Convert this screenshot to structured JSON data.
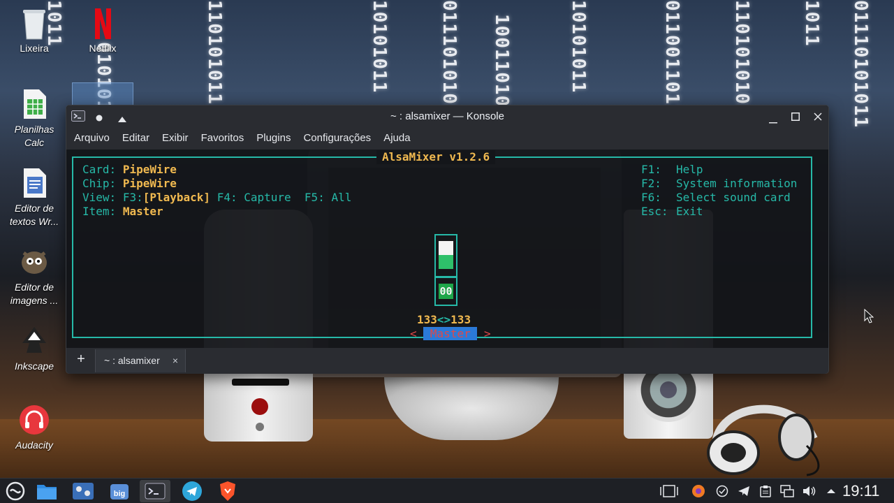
{
  "desktop": {
    "icons": [
      {
        "label": "Lixeira",
        "icon": "trash-icon"
      },
      {
        "label": "Netflix",
        "icon": "netflix-icon"
      },
      {
        "label": "Planilhas Calc",
        "icon": "spreadsheet-icon"
      },
      {
        "label": "Editor de textos Wr...",
        "icon": "text-document-icon"
      },
      {
        "label": "Editor de imagens ...",
        "icon": "gimp-icon"
      },
      {
        "label": "Inkscape",
        "icon": "inkscape-icon"
      },
      {
        "label": "Audacity",
        "icon": "audacity-icon"
      }
    ],
    "wallpaper_binary": [
      "1011",
      "0101011",
      "110101011",
      "10101011",
      "01110101011",
      "100110101",
      "10101011",
      "01100110111",
      "11010101011",
      "1011",
      "01110101011"
    ]
  },
  "window": {
    "title": "~ : alsamixer — Konsole",
    "menu": [
      "Arquivo",
      "Editar",
      "Exibir",
      "Favoritos",
      "Plugins",
      "Configurações",
      "Ajuda"
    ],
    "tab_label": "~ : alsamixer",
    "new_tab": "+",
    "close_tab": "×"
  },
  "alsamixer": {
    "title": "AlsaMixer v1.2.6",
    "card_label": "Card:",
    "card_value": "PipeWire",
    "chip_label": "Chip:",
    "chip_value": "PipeWire",
    "view_label": "View:",
    "view_f3_key": "F3:",
    "view_f3": "[Playback]",
    "view_f4": "F4: Capture",
    "view_f5": "F5: All",
    "item_label": "Item:",
    "item_value": "Master",
    "help": [
      {
        "key": "F1:",
        "text": "Help"
      },
      {
        "key": "F2:",
        "text": "System information"
      },
      {
        "key": "F6:",
        "text": "Select sound card"
      },
      {
        "key": "Esc:",
        "text": "Exit"
      }
    ],
    "mute_indicator": "00",
    "volume_left": "133",
    "volume_sep": "<>",
    "volume_right": "133",
    "control_prefix": "<",
    "control_name": " Master ",
    "control_suffix": ">",
    "volume_level_fraction": 0.5
  },
  "taskbar": {
    "apps": [
      "biglinux-menu-icon",
      "file-manager-icon",
      "control-center-icon",
      "big-store-icon",
      "konsole-icon",
      "telegram-icon",
      "brave-icon"
    ],
    "tray": [
      "window-switcher-icon",
      "firefox-tray-icon",
      "check-icon",
      "telegram-tray-icon",
      "clipboard-icon",
      "network-icon",
      "volume-icon",
      "expand-tray-icon"
    ],
    "clock": "19:11"
  },
  "colors": {
    "accent_teal": "#26b9a8",
    "label_yellow": "#f0b950",
    "selection_blue": "#2b7ad8",
    "control_red": "#e04848"
  }
}
